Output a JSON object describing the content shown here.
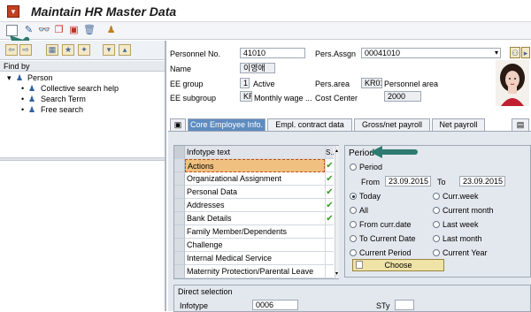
{
  "window": {
    "title": "Maintain HR Master Data"
  },
  "toolbar": {
    "icons": [
      "create-icon",
      "edit-icon",
      "display-icon",
      "copy-icon",
      "delimit-icon",
      "delete-icon",
      "overview-icon"
    ]
  },
  "left_pane": {
    "find_by": "Find by",
    "tree_root": "Person",
    "tree_items": [
      "Collective search help",
      "Search Term",
      "Free search"
    ]
  },
  "header": {
    "personnel_no_label": "Personnel No.",
    "personnel_no": "41010",
    "pers_assgn_label": "Pers.Assgn",
    "pers_assgn": "00041010",
    "name_label": "Name",
    "name": "이영애",
    "ee_group_label": "EE group",
    "ee_group_code": "1",
    "ee_group_text": "Active",
    "pers_area_label": "Pers.area",
    "pers_area_code": "KR01",
    "pers_area_text": "Personnel area",
    "ee_subgroup_label": "EE subgroup",
    "ee_subgroup_code": "KR",
    "ee_subgroup_text": "Monthly wage ...",
    "cost_center_label": "Cost Center",
    "cost_center": "2000"
  },
  "tabs": [
    "Core Employee Info.",
    "Empl. contract data",
    "Gross/net payroll",
    "Net payroll"
  ],
  "infotype_table": {
    "header": "Infotype text",
    "header_status": "S..",
    "rows": [
      {
        "text": "Actions",
        "check": true
      },
      {
        "text": "Organizational Assignment",
        "check": true
      },
      {
        "text": "Personal Data",
        "check": true
      },
      {
        "text": "Addresses",
        "check": true
      },
      {
        "text": "Bank Details",
        "check": true
      },
      {
        "text": "Family Member/Dependents",
        "check": false
      },
      {
        "text": "Challenge",
        "check": false
      },
      {
        "text": "Internal Medical Service",
        "check": false
      },
      {
        "text": "Maternity Protection/Parental Leave",
        "check": false
      }
    ]
  },
  "period": {
    "title": "Period",
    "period_label": "Period",
    "from_label": "From",
    "from": "23.09.2015",
    "to_label": "To",
    "to": "23.09.2015",
    "options_left": [
      "Today",
      "All",
      "From curr.date",
      "To Current Date",
      "Current Period"
    ],
    "options_right": [
      "Curr.week",
      "Current month",
      "Last week",
      "Last month",
      "Current Year"
    ],
    "selected": "Today",
    "choose_label": "Choose"
  },
  "direct_selection": {
    "title": "Direct selection",
    "infotype_label": "Infotype",
    "infotype": "0006",
    "sty_label": "STy",
    "sty": ""
  },
  "colors": {
    "active_tab": "#5e8cc0",
    "selected_row": "#f0c080",
    "annotation_arrow": "#2e7a70"
  }
}
